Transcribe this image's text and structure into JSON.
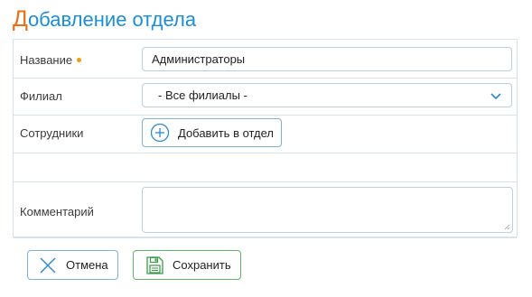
{
  "page": {
    "title_first_letter": "Д",
    "title_rest": "обавление отдела"
  },
  "form": {
    "name": {
      "label": "Название",
      "value": "Администраторы",
      "required": true
    },
    "branch": {
      "label": "Филиал",
      "value": "- Все филиалы -"
    },
    "employees": {
      "label": "Сотрудники",
      "add_button_label": "Добавить в отдел"
    },
    "comment": {
      "label": "Комментарий",
      "value": ""
    }
  },
  "actions": {
    "cancel_label": "Отмена",
    "save_label": "Сохранить"
  },
  "icons": {
    "required": "required-dot-icon",
    "chevron": "chevron-down-icon",
    "add": "plus-circle-icon",
    "cancel": "close-x-icon",
    "save": "floppy-disk-icon"
  },
  "colors": {
    "title": "#1a8fd8",
    "title_accent": "#e8701a",
    "required_dot": "#f39c12",
    "primary_border": "#7fb0d6",
    "save_border": "#5fb66a",
    "icon_blue": "#2a8ad4",
    "icon_green": "#3a9a48"
  }
}
